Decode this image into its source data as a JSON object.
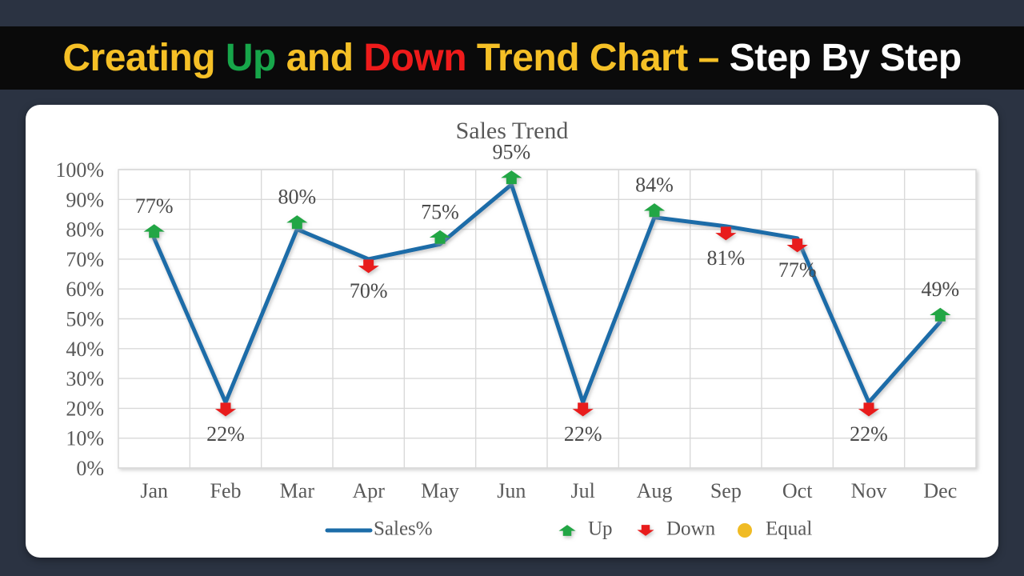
{
  "banner": {
    "segments": [
      {
        "text": "Creating ",
        "color": "#f5c026"
      },
      {
        "text": "Up",
        "color": "#17a64a"
      },
      {
        "text": " and ",
        "color": "#f5c026"
      },
      {
        "text": "Down",
        "color": "#ee1b1b"
      },
      {
        "text": " Trend Chart ",
        "color": "#f5c026"
      },
      {
        "text": "– ",
        "color": "#f5c026"
      },
      {
        "text": "Step By Step",
        "color": "#ffffff"
      }
    ],
    "full_text": "Creating Up and Down Trend Chart – Step By Step",
    "background": "#0a0a0a"
  },
  "page": {
    "background": "#2b3342",
    "card_background": "#ffffff"
  },
  "chart_data": {
    "type": "line",
    "title": "Sales Trend",
    "xlabel": "",
    "ylabel": "",
    "ylim": [
      0,
      100
    ],
    "ytick_labels": [
      "0%",
      "10%",
      "20%",
      "30%",
      "40%",
      "50%",
      "60%",
      "70%",
      "80%",
      "90%",
      "100%"
    ],
    "ytick_values": [
      0,
      10,
      20,
      30,
      40,
      50,
      60,
      70,
      80,
      90,
      100
    ],
    "grid": true,
    "legend_position": "bottom",
    "categories": [
      "Jan",
      "Feb",
      "Mar",
      "Apr",
      "May",
      "Jun",
      "Jul",
      "Aug",
      "Sep",
      "Oct",
      "Nov",
      "Dec"
    ],
    "series": [
      {
        "name": "Sales%",
        "color": "#1b6ca8",
        "values": [
          77,
          22,
          80,
          70,
          75,
          95,
          22,
          84,
          81,
          77,
          22,
          49
        ]
      }
    ],
    "data_labels": [
      "77%",
      "22%",
      "80%",
      "70%",
      "75%",
      "95%",
      "22%",
      "84%",
      "81%",
      "77%",
      "22%",
      "49%"
    ],
    "markers": [
      "up",
      "down",
      "up",
      "down",
      "up",
      "up",
      "down",
      "up",
      "down",
      "down",
      "down",
      "up"
    ],
    "label_placement": [
      "above",
      "below",
      "above",
      "below",
      "above",
      "above",
      "below",
      "above",
      "below",
      "below",
      "below",
      "above"
    ],
    "legend": [
      {
        "label": "Sales%",
        "marker": "line",
        "color": "#1b6ca8"
      },
      {
        "label": "Up",
        "marker": "up-arrow",
        "color": "#21a645"
      },
      {
        "label": "Down",
        "marker": "down-arrow",
        "color": "#e81c1c"
      },
      {
        "label": "Equal",
        "marker": "circle",
        "color": "#f0bb24"
      }
    ]
  }
}
